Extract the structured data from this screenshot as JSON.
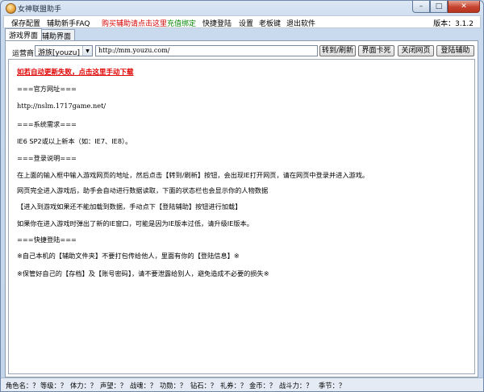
{
  "window": {
    "title": "女神联盟助手"
  },
  "menu": {
    "items": [
      {
        "label": "保存配置"
      },
      {
        "label": "辅助新手FAQ"
      },
      {
        "label": "购买辅助请点击这里"
      },
      {
        "label": "充值绑定"
      },
      {
        "label": "快捷登陆"
      },
      {
        "label": "设置"
      },
      {
        "label": "老板键"
      },
      {
        "label": "退出软件"
      }
    ],
    "version": "版本：3.1.2"
  },
  "tabs": [
    {
      "label": "游戏界面"
    },
    {
      "label": "辅助界面"
    }
  ],
  "toolbar": {
    "operator_label": "运营商",
    "operator_value": "游族[youzu]",
    "url_value": "http://mm.youzu.com/",
    "buttons": {
      "goto": "转到/刷新",
      "lag": "界面卡死",
      "close_page": "关闭网页",
      "login_assist": "登陆辅助"
    }
  },
  "content": {
    "lines": [
      "如若自动更新失败，点击这里手动下载",
      "===官方网址===",
      "http://nslm.1717game.net/",
      "===系统需求===",
      "IE6 SP2或以上新本（如：IE7、IE8）。",
      "===登录说明===",
      "在上面的输入框中输入游戏网页的地址，然后点击【转到/刷新】按钮，会出现IE打开网页，请在网页中登录并进入游戏。",
      "网页完全进入游戏后，助手会自动进行数据读取，下面的状态栏也会显示你的人物数据",
      "【进入到游戏如果还不能加载到数据，手动点下【登陆辅助】按钮进行加载】",
      "如果你在进入游戏时弹出了新的IE窗口，可能是因为IE版本过低，请升级IE版本。",
      "===快捷登陆===",
      "※自己本机的【辅助文件夹】不要打包传给他人，里面有你的【登陆信息】※",
      "※保管好自己的【存档】及【账号密码】，请不要泄露给别人，避免造成不必要的损失※"
    ]
  },
  "status": {
    "fields": [
      "角色名：？",
      "等级：？",
      "体力：？",
      "声望：？",
      "战魂：？",
      "功勋：？",
      "钻石：？",
      "礼券：？",
      "金币：？",
      "战斗力：？",
      "季节：？"
    ]
  },
  "colors": {
    "title_bar": "#dce7f5",
    "highlight_red": "#d40000",
    "highlight_green": "#0a8a0a"
  }
}
